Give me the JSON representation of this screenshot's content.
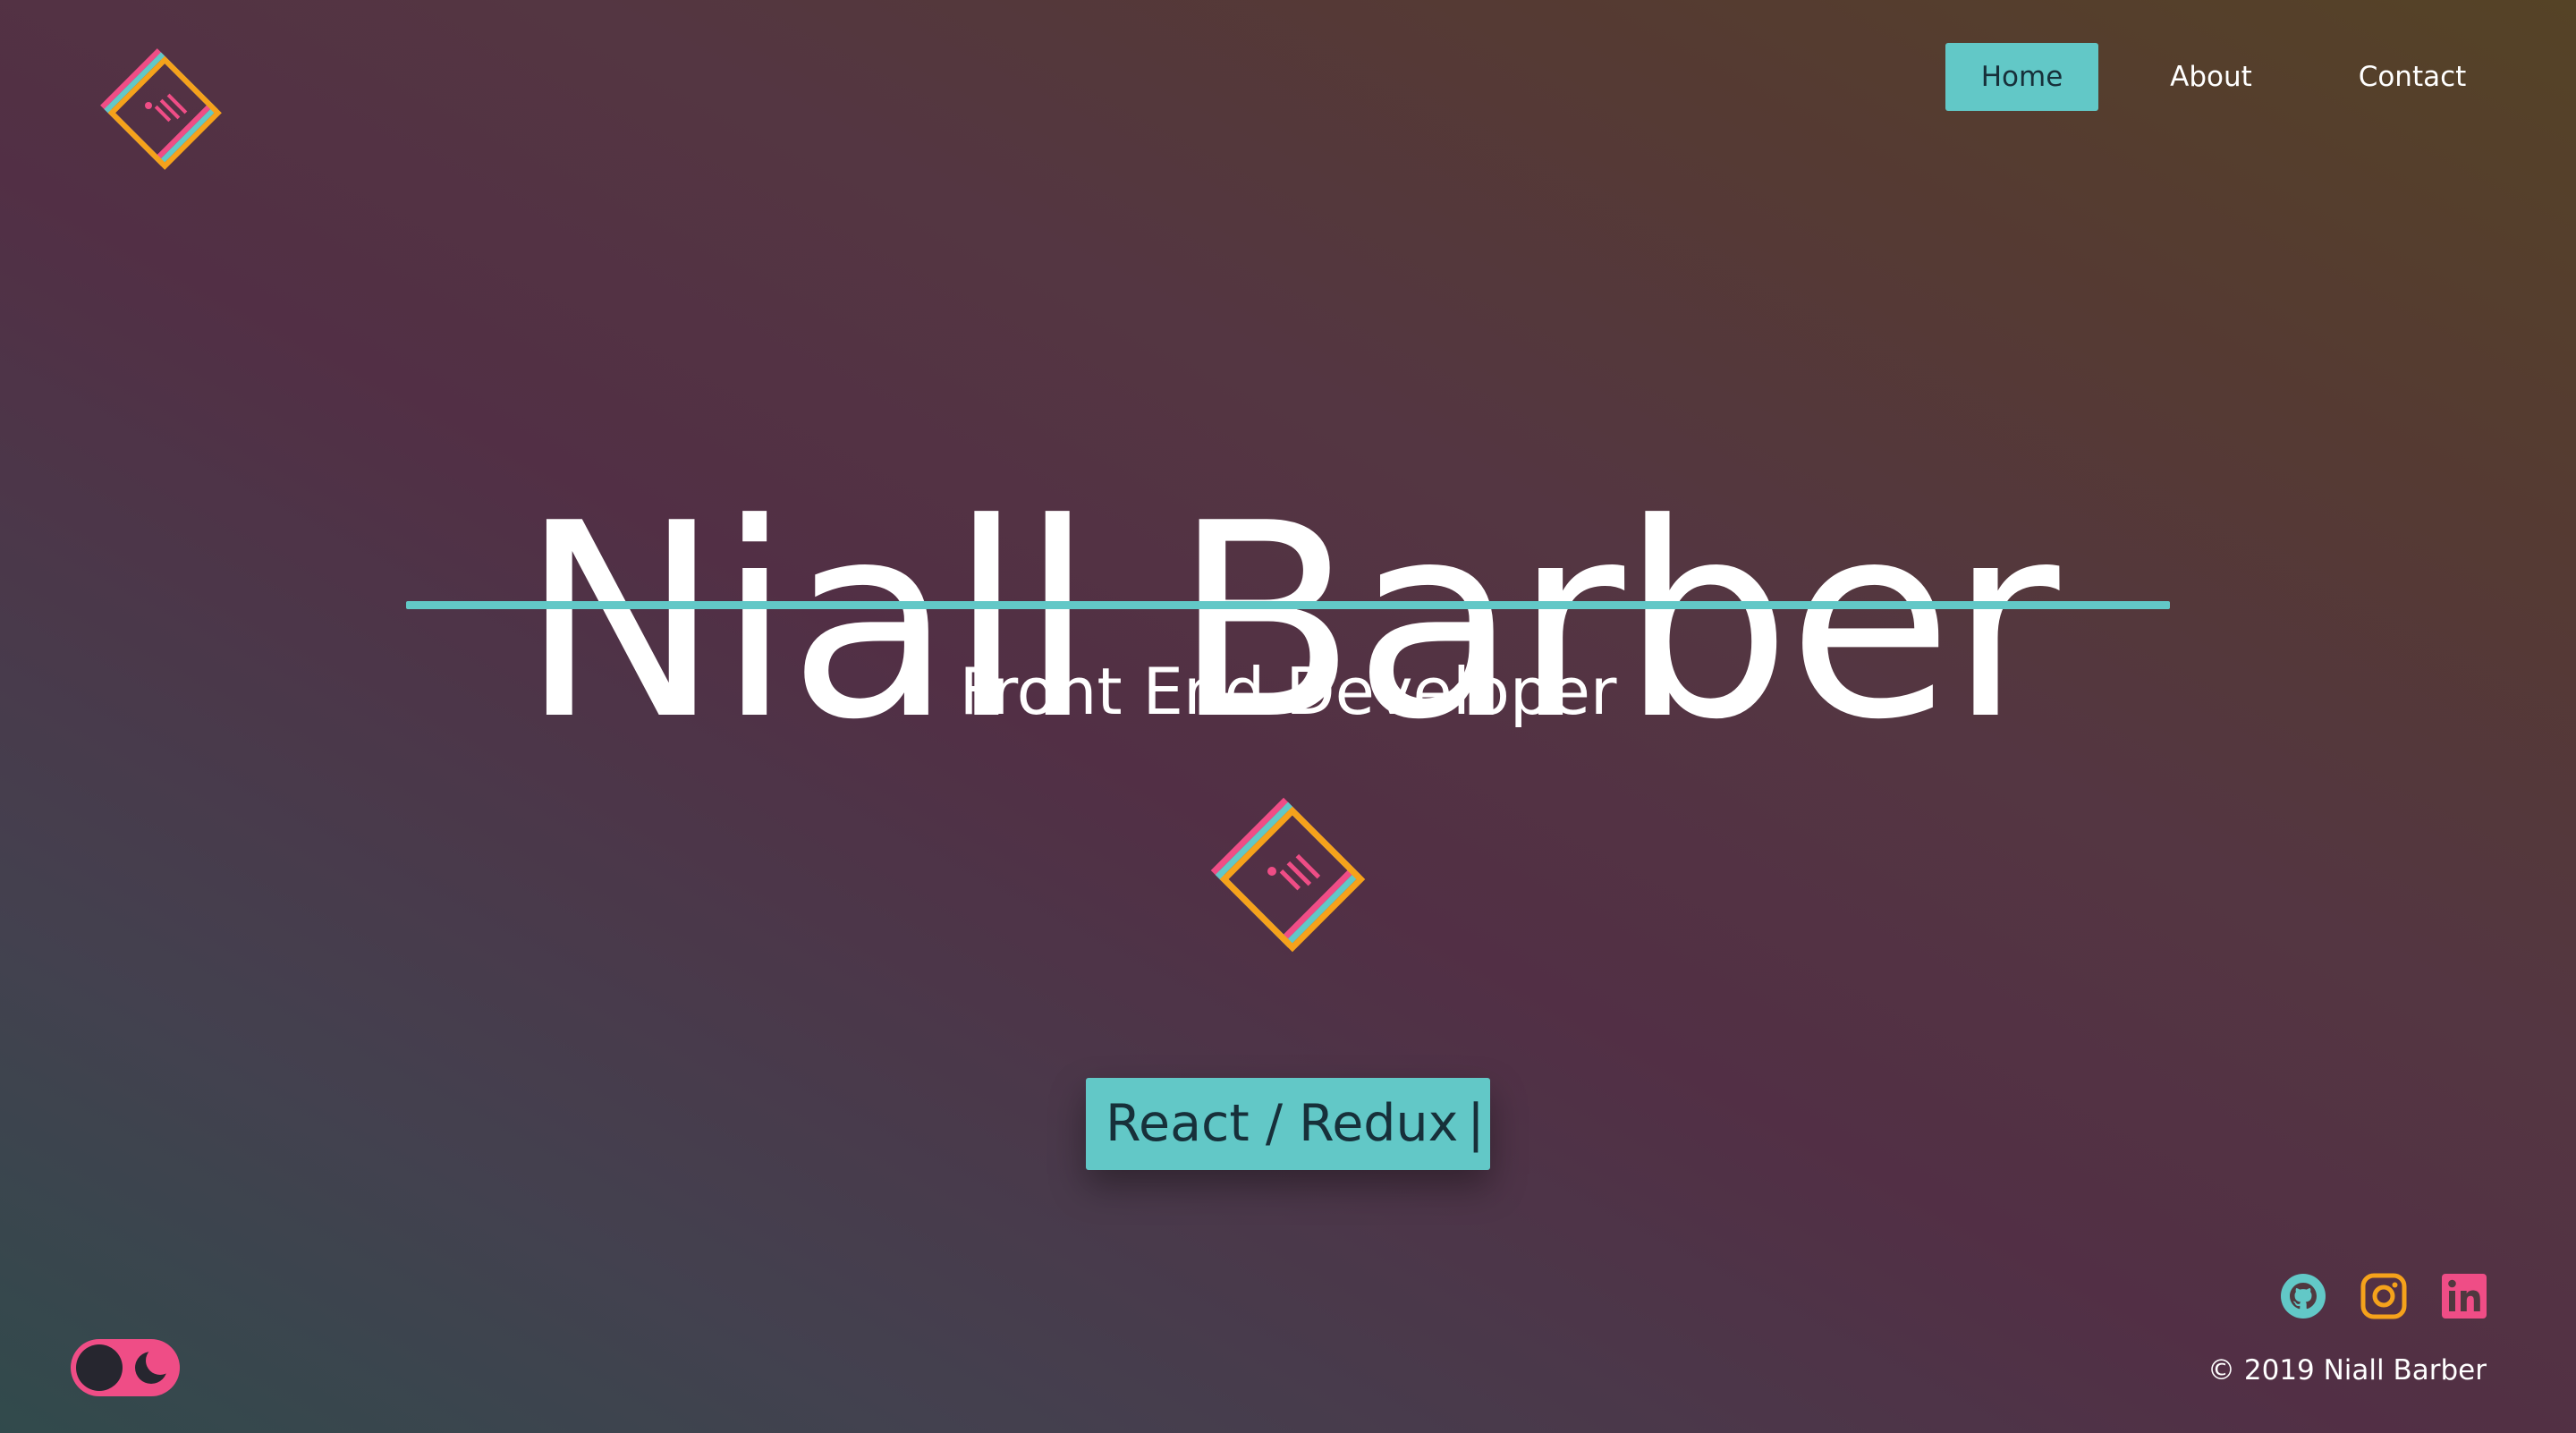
{
  "nav": {
    "items": [
      {
        "label": "Home",
        "active": true
      },
      {
        "label": "About",
        "active": false
      },
      {
        "label": "Contact",
        "active": false
      }
    ]
  },
  "hero": {
    "name": "Niall Barber",
    "role": "Front End Developer",
    "typing_text": "React / Redux",
    "typing_cursor": "|"
  },
  "footer": {
    "copyright": "© 2019 Niall Barber",
    "social": [
      "github-icon",
      "instagram-icon",
      "linkedin-icon"
    ]
  },
  "theme_toggle": {
    "state": "dark",
    "icon": "moon-icon"
  },
  "colors": {
    "accent_teal": "#62c8c7",
    "accent_pink": "#ef4d86",
    "accent_orange": "#f5a21b",
    "text_dark": "#17303a"
  }
}
